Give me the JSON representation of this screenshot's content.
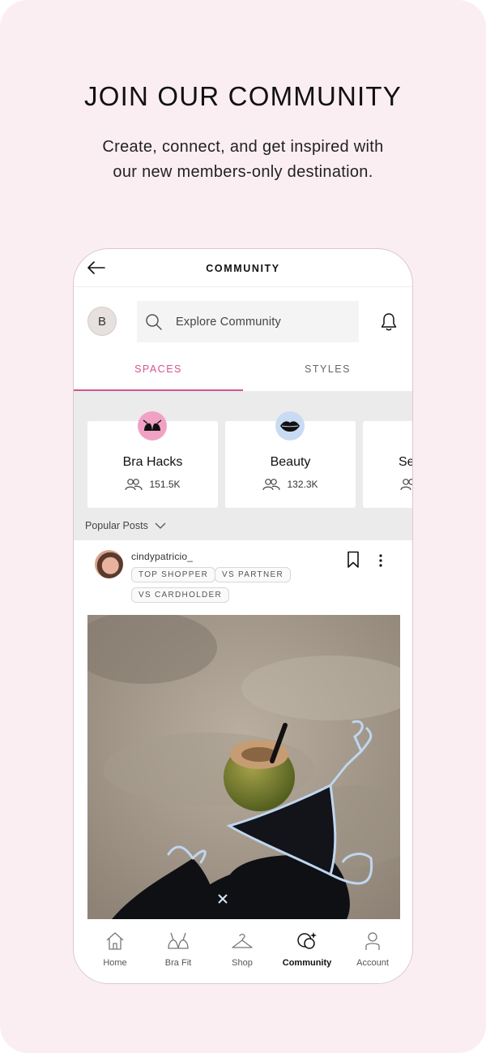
{
  "promo": {
    "headline": "JOIN OUR COMMUNITY",
    "subline_1": "Create, connect, and get inspired with",
    "subline_2": "our new members-only destination."
  },
  "app": {
    "title": "COMMUNITY",
    "avatar_initial": "B",
    "search": {
      "placeholder": "Explore Community"
    },
    "tabs": [
      {
        "label": "SPACES",
        "active": true
      },
      {
        "label": "STYLES",
        "active": false
      }
    ],
    "spaces": [
      {
        "name": "Bra Hacks",
        "members": "151.5K",
        "icon": "bra-icon",
        "icon_bg": "#f1a2c4"
      },
      {
        "name": "Beauty",
        "members": "132.3K",
        "icon": "lips-icon",
        "icon_bg": "#c9dbf3"
      },
      {
        "name": "Se",
        "members": "",
        "icon": "",
        "icon_bg": "#ffffff"
      }
    ],
    "popular_label": "Popular Posts",
    "post": {
      "username": "cindypatricio_",
      "tags": [
        "TOP SHOPPER",
        "VS PARTNER",
        "VS CARDHOLDER"
      ],
      "image": "beach-bikini-coconut-photo"
    },
    "nav": [
      {
        "label": "Home",
        "icon": "home-icon",
        "active": false
      },
      {
        "label": "Bra Fit",
        "icon": "bra-fit-icon",
        "active": false
      },
      {
        "label": "Shop",
        "icon": "hanger-icon",
        "active": false
      },
      {
        "label": "Community",
        "icon": "community-icon",
        "active": true
      },
      {
        "label": "Account",
        "icon": "account-icon",
        "active": false
      }
    ],
    "colors": {
      "accent": "#d5528f",
      "background": "#fbeef2"
    }
  }
}
